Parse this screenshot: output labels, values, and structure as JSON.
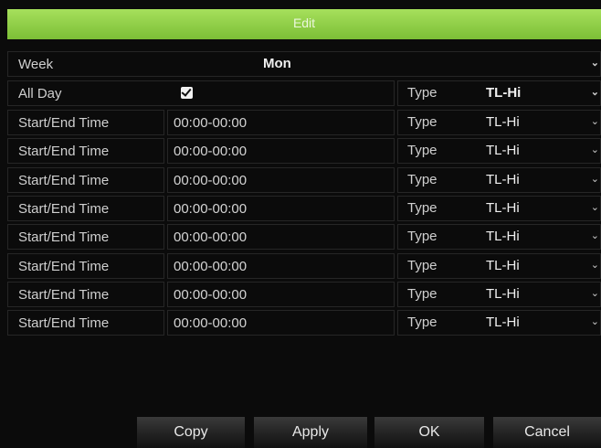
{
  "dialog": {
    "title": "Edit"
  },
  "week": {
    "label": "Week",
    "value": "Mon"
  },
  "all_day": {
    "label": "All Day",
    "checked": true,
    "type_label": "Type",
    "type_value": "TL-Hi"
  },
  "time_rows": [
    {
      "label": "Start/End Time",
      "time": "00:00-00:00",
      "type_label": "Type",
      "type_value": "TL-Hi"
    },
    {
      "label": "Start/End Time",
      "time": "00:00-00:00",
      "type_label": "Type",
      "type_value": "TL-Hi"
    },
    {
      "label": "Start/End Time",
      "time": "00:00-00:00",
      "type_label": "Type",
      "type_value": "TL-Hi"
    },
    {
      "label": "Start/End Time",
      "time": "00:00-00:00",
      "type_label": "Type",
      "type_value": "TL-Hi"
    },
    {
      "label": "Start/End Time",
      "time": "00:00-00:00",
      "type_label": "Type",
      "type_value": "TL-Hi"
    },
    {
      "label": "Start/End Time",
      "time": "00:00-00:00",
      "type_label": "Type",
      "type_value": "TL-Hi"
    },
    {
      "label": "Start/End Time",
      "time": "00:00-00:00",
      "type_label": "Type",
      "type_value": "TL-Hi"
    },
    {
      "label": "Start/End Time",
      "time": "00:00-00:00",
      "type_label": "Type",
      "type_value": "TL-Hi"
    }
  ],
  "buttons": {
    "copy": "Copy",
    "apply": "Apply",
    "ok": "OK",
    "cancel": "Cancel"
  },
  "icons": {
    "dropdown": "chevron-down-icon",
    "checkbox": "checkmark-icon"
  },
  "colors": {
    "title_bar": "#8fcf45",
    "background": "#0b0b0b",
    "cell_border": "#262626"
  }
}
